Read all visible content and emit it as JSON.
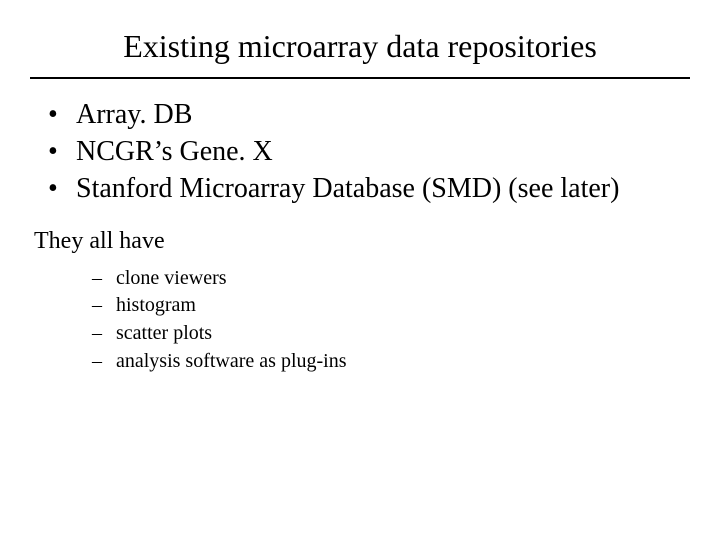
{
  "title": "Existing microarray data repositories",
  "bullets": [
    "Array. DB",
    "NCGR’s Gene. X",
    "Stanford Microarray Database (SMD) (see later)"
  ],
  "subhead": "They all have",
  "dashes": [
    "clone viewers",
    "histogram",
    "scatter plots",
    "analysis software as plug-ins"
  ]
}
